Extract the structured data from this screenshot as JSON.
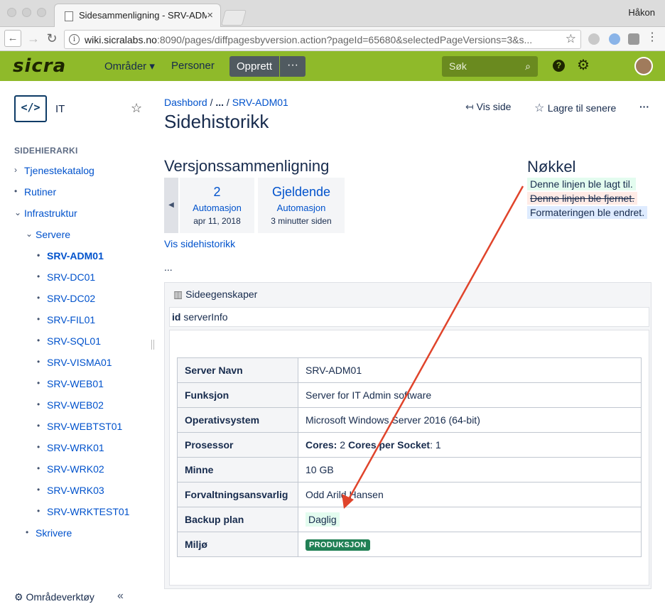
{
  "browser": {
    "tab_title": "Sidesammenligning - SRV-ADM",
    "user": "Håkon",
    "url_host": "wiki.sicralabs.no",
    "url_rest": ":8090/pages/diffpagesbyversion.action?pageId=65680&selectedPageVersions=3&s..."
  },
  "header": {
    "logo": "sicra",
    "nav": [
      "Områder ▾",
      "Personer"
    ],
    "create_label": "Opprett",
    "create_more": "···",
    "search_placeholder": "Søk",
    "help": "?"
  },
  "sidebar": {
    "space_icon": "</>",
    "space_name": "IT",
    "heading": "SIDEHIERARKI",
    "items": [
      {
        "label": "Tjenestekatalog",
        "marker": "›"
      },
      {
        "label": "Rutiner",
        "marker": "•"
      },
      {
        "label": "Infrastruktur",
        "marker": "⌄"
      },
      {
        "label": "Servere",
        "marker": "⌄"
      },
      {
        "label": "SRV-ADM01",
        "marker": "•"
      },
      {
        "label": "SRV-DC01",
        "marker": "•"
      },
      {
        "label": "SRV-DC02",
        "marker": "•"
      },
      {
        "label": "SRV-FIL01",
        "marker": "•"
      },
      {
        "label": "SRV-SQL01",
        "marker": "•"
      },
      {
        "label": "SRV-VISMA01",
        "marker": "•"
      },
      {
        "label": "SRV-WEB01",
        "marker": "•"
      },
      {
        "label": "SRV-WEB02",
        "marker": "•"
      },
      {
        "label": "SRV-WEBTST01",
        "marker": "•"
      },
      {
        "label": "SRV-WRK01",
        "marker": "•"
      },
      {
        "label": "SRV-WRK02",
        "marker": "•"
      },
      {
        "label": "SRV-WRK03",
        "marker": "•"
      },
      {
        "label": "SRV-WRKTEST01",
        "marker": "•"
      },
      {
        "label": "Skrivere",
        "marker": "•"
      }
    ],
    "tools_label": "Områdeverktøy",
    "collapse": "«"
  },
  "main": {
    "breadcrumb": {
      "root": "Dashbord",
      "sep1": " / ",
      "ellipsis": "...",
      "sep2": " / ",
      "page": "SRV-ADM01"
    },
    "title": "Sidehistorikk",
    "actions": {
      "view": "Vis side",
      "save": "Lagre til senere",
      "more": "···"
    },
    "compare_heading": "Versjonssammenligning",
    "versions": [
      {
        "number": "2",
        "author": "Automasjon",
        "date": "apr 11, 2018"
      },
      {
        "number": "Gjeldende",
        "author": "Automasjon",
        "date": "3 minutter siden"
      }
    ],
    "history_link": "Vis sidehistorikk",
    "ellipsis": "...",
    "key": {
      "heading": "Nøkkel",
      "added": "Denne linjen ble lagt til.",
      "removed": "Denne linjen ble fjernet.",
      "changed": "Formateringen ble endret."
    },
    "properties": {
      "heading": "Sideegenskaper",
      "id_label": "id",
      "id_value": "serverInfo",
      "rows": [
        {
          "key": "Server Navn",
          "value": "SRV-ADM01"
        },
        {
          "key": "Funksjon",
          "value": "Server for IT Admin software"
        },
        {
          "key": "Operativsystem",
          "value": "Microsoft Windows Server 2016 (64-bit)"
        },
        {
          "key": "Prosessor",
          "value_parts": {
            "b1": "Cores:",
            "v1": " 2 ",
            "b2": "Cores per Socket",
            "v2": ": 1"
          }
        },
        {
          "key": "Minne",
          "value": "10 GB"
        },
        {
          "key": "Forvaltningsansvarlig",
          "value": "Odd Arild Hansen"
        },
        {
          "key": "Backup plan",
          "value": "Daglig"
        },
        {
          "key": "Miljø",
          "value": "PRODUKSJON"
        }
      ]
    }
  },
  "colors": {
    "header": "#8fba2a",
    "link": "#0052cc",
    "added": "#e3fcef",
    "removed": "#ffebe6",
    "changed": "#deebff",
    "arrow": "#e0442b",
    "lozenge": "#218055"
  }
}
